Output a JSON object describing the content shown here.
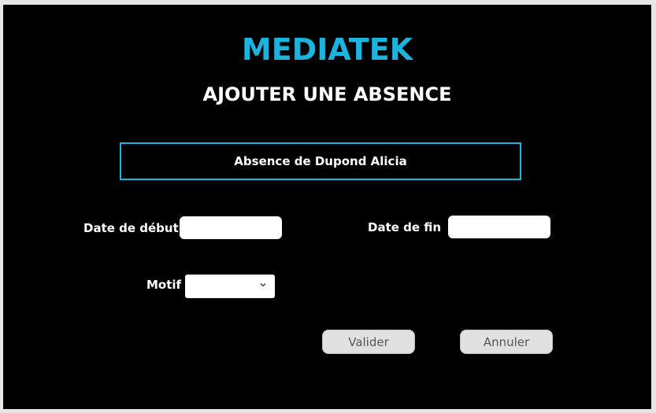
{
  "app": {
    "brand": "MEDIATEK",
    "title": "AJOUTER UNE ABSENCE"
  },
  "employee": {
    "banner": "Absence de Dupond Alicia"
  },
  "form": {
    "start_label": "Date de début",
    "start_value": "",
    "end_label": "Date de fin",
    "end_value": "",
    "motif_label": "Motif",
    "motif_selected": ""
  },
  "actions": {
    "validate_label": "Valider",
    "cancel_label": "Annuler"
  },
  "colors": {
    "accent": "#1bb4df",
    "background": "#000000",
    "text": "#ffffff",
    "button_bg": "#e1e1e1"
  }
}
